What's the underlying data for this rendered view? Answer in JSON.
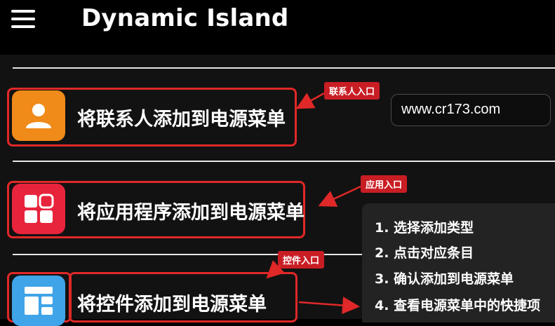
{
  "appbar": {
    "title": "Dynamic Island",
    "menu_icon": "hamburger-menu-icon"
  },
  "rows": [
    {
      "label": "将联系人添加到电源菜单",
      "icon": "person-icon",
      "icon_color": "#f08a18"
    },
    {
      "label": "将应用程序添加到电源菜单",
      "icon": "app-grid-icon",
      "icon_color": "#e8243d"
    },
    {
      "label": "将控件添加到电源菜单",
      "icon": "widget-dashboard-icon",
      "icon_color": "#3fa4e8"
    }
  ],
  "annotations": {
    "contact_tag": "联系人入口",
    "app_tag": "应用入口",
    "widget_tag": "控件入口",
    "watermark": "www.cr173.com",
    "steps": [
      "1. 选择添加类型",
      "2. 点击对应条目",
      "3. 确认添加到电源菜单",
      "4. 查看电源菜单中的快捷项"
    ]
  },
  "colors": {
    "highlight": "#e02828",
    "tag_bg": "#c91d24",
    "background": "#121212"
  }
}
